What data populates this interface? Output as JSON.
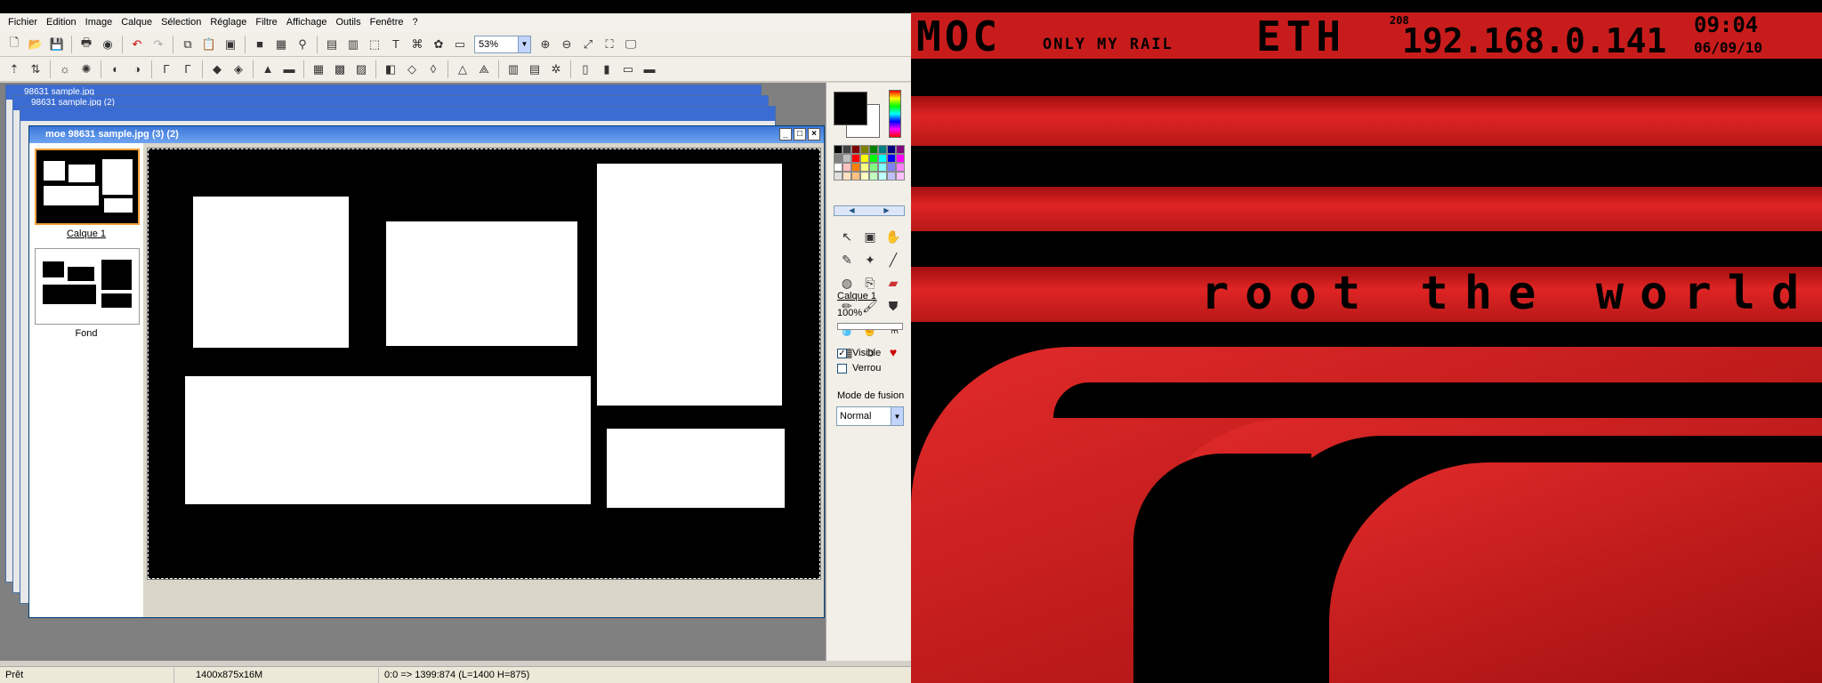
{
  "menubar": {
    "items": [
      "Fichier",
      "Edition",
      "Image",
      "Calque",
      "Sélection",
      "Réglage",
      "Filtre",
      "Affichage",
      "Outils",
      "Fenêtre",
      "?"
    ]
  },
  "toolbar": {
    "zoom_value": "53%"
  },
  "document": {
    "title": "moe 98631 sample.jpg (3) (2)",
    "ghost_title_1": "98631 sample.jpg",
    "ghost_title_2": "98631 sample.jpg (2)"
  },
  "layers": {
    "items": [
      {
        "label": "Calque 1",
        "selected": true
      },
      {
        "label": "Fond",
        "selected": false
      }
    ]
  },
  "rightpanel": {
    "layer_name": "Calque 1",
    "opacity": "100%",
    "visible_label": "Visible",
    "visible_checked": "✓",
    "lock_label": "Verrou",
    "blend_label": "Mode de fusion",
    "blend_value": "Normal"
  },
  "statusbar": {
    "status": "Prêt",
    "size": "1400x875x16M",
    "coords": "0:0 => 1399:874 (L=1400  H=875)"
  },
  "wallpaper": {
    "title_left": "MOC",
    "subtitle": "ONLY MY RAIL",
    "eth": "ETH",
    "label_small": "208",
    "ip": "192.168.0.141",
    "time": "09:04",
    "date": "06/09/10",
    "slogan": "root the world"
  },
  "colors": {
    "accent_red": "#d62020",
    "xp_title": "#3b77d9",
    "selection_orange": "#f3a13b"
  }
}
